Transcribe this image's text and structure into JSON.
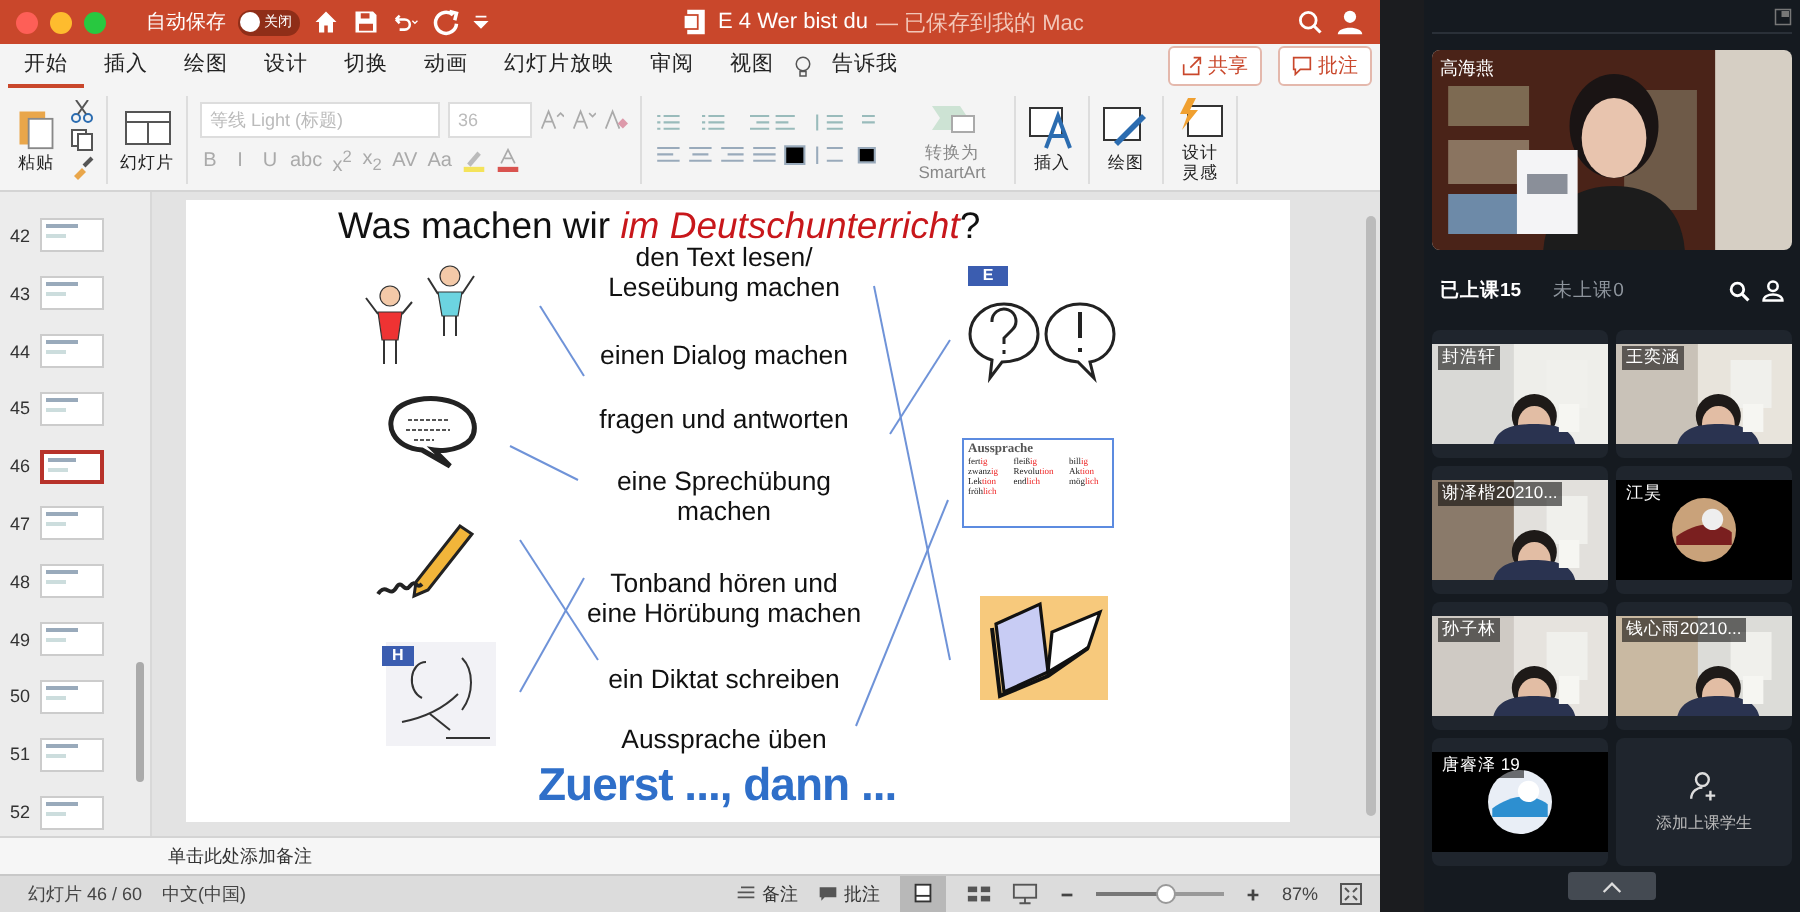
{
  "window": {
    "autosave_label": "自动保存",
    "autosave": {
      "on": false,
      "label": "关闭"
    },
    "title": "E 4 Wer bist du",
    "subtitle": "— 已保存到我的 Mac"
  },
  "ribbon_tabs": [
    {
      "label": "开始",
      "selected": true
    },
    {
      "label": "插入",
      "selected": false
    },
    {
      "label": "绘图",
      "selected": false
    },
    {
      "label": "设计",
      "selected": false
    },
    {
      "label": "切换",
      "selected": false
    },
    {
      "label": "动画",
      "selected": false
    },
    {
      "label": "幻灯片放映",
      "selected": false
    },
    {
      "label": "审阅",
      "selected": false
    },
    {
      "label": "视图",
      "selected": false
    }
  ],
  "tell_me": "告诉我",
  "share_button": "共享",
  "comment_button": "批注",
  "ribbon": {
    "paste": "粘贴",
    "slide": "幻灯片",
    "font_name": "等线 Light (标题)",
    "font_size": "36",
    "format_buttons": [
      "B",
      "I",
      "U",
      "abc",
      "x$^{2}$",
      "x$_{2}$",
      "AV",
      "Aa"
    ],
    "smartart": [
      "转换为",
      "SmartArt"
    ],
    "insert": "插入",
    "draw": "绘图",
    "design": [
      "设计",
      "灵感"
    ]
  },
  "thumbnails": [
    {
      "number": "42",
      "selected": false
    },
    {
      "number": "43",
      "selected": false
    },
    {
      "number": "44",
      "selected": false
    },
    {
      "number": "45",
      "selected": false
    },
    {
      "number": "46",
      "selected": true
    },
    {
      "number": "47",
      "selected": false
    },
    {
      "number": "48",
      "selected": false
    },
    {
      "number": "49",
      "selected": false
    },
    {
      "number": "50",
      "selected": false
    },
    {
      "number": "51",
      "selected": false
    },
    {
      "number": "52",
      "selected": false
    }
  ],
  "slide": {
    "title": "Was machen wir ",
    "title_accent": "im Deutschunterricht",
    "title_end": "?",
    "phrases": [
      "den Text lesen/\nLeseübung machen",
      "einen Dialog machen",
      "fragen und antworten",
      "eine Sprechübung\nmachen",
      "Tonband hören und\neine Hörübung machen",
      "ein Diktat schreiben",
      "Aussprache üben"
    ],
    "badges": [
      "E",
      "H"
    ],
    "card_title": "Aussprache",
    "card_words": [
      {
        "stem": "fert",
        "ending": "ig"
      },
      {
        "stem": "fleiß",
        "ending": "ig"
      },
      {
        "stem": "bill",
        "ending": "ig"
      },
      {
        "stem": "zwanz",
        "ending": "ig"
      },
      {
        "stem": "Revolu",
        "ending": "tion"
      },
      {
        "stem": "Ak",
        "ending": "tion"
      },
      {
        "stem": "Lek",
        "ending": "tion"
      },
      {
        "stem": "end",
        "ending": "lich"
      },
      {
        "stem": "mög",
        "ending": "lich"
      },
      {
        "stem": "fröh",
        "ending": "lich"
      }
    ],
    "footer": "Zuerst ..., dann ..."
  },
  "notes_placeholder": "单击此处添加备注",
  "status_bar": {
    "slide_counter": "幻灯片 46 / 60",
    "language": "中文(中国)",
    "notes": "备注",
    "comments": "批注",
    "zoom": "87%",
    "level": 0.55
  },
  "class_panel": {
    "teacher": "高海燕",
    "tabs": [
      {
        "label": "已上课15",
        "selected": true
      },
      {
        "label": "未上课0",
        "selected": false
      }
    ],
    "students": [
      {
        "name": "封浩轩",
        "kind": "video"
      },
      {
        "name": "王奕涵",
        "kind": "video"
      },
      {
        "name": "谢泽楷20210...",
        "kind": "video"
      },
      {
        "name": "江昊"
      },
      {
        "name": "孙子林",
        "kind": "video"
      },
      {
        "name": "钱心雨20210...",
        "kind": "video"
      },
      {
        "name": "唐睿泽 19"
      }
    ],
    "add_student": "添加上课学生"
  }
}
